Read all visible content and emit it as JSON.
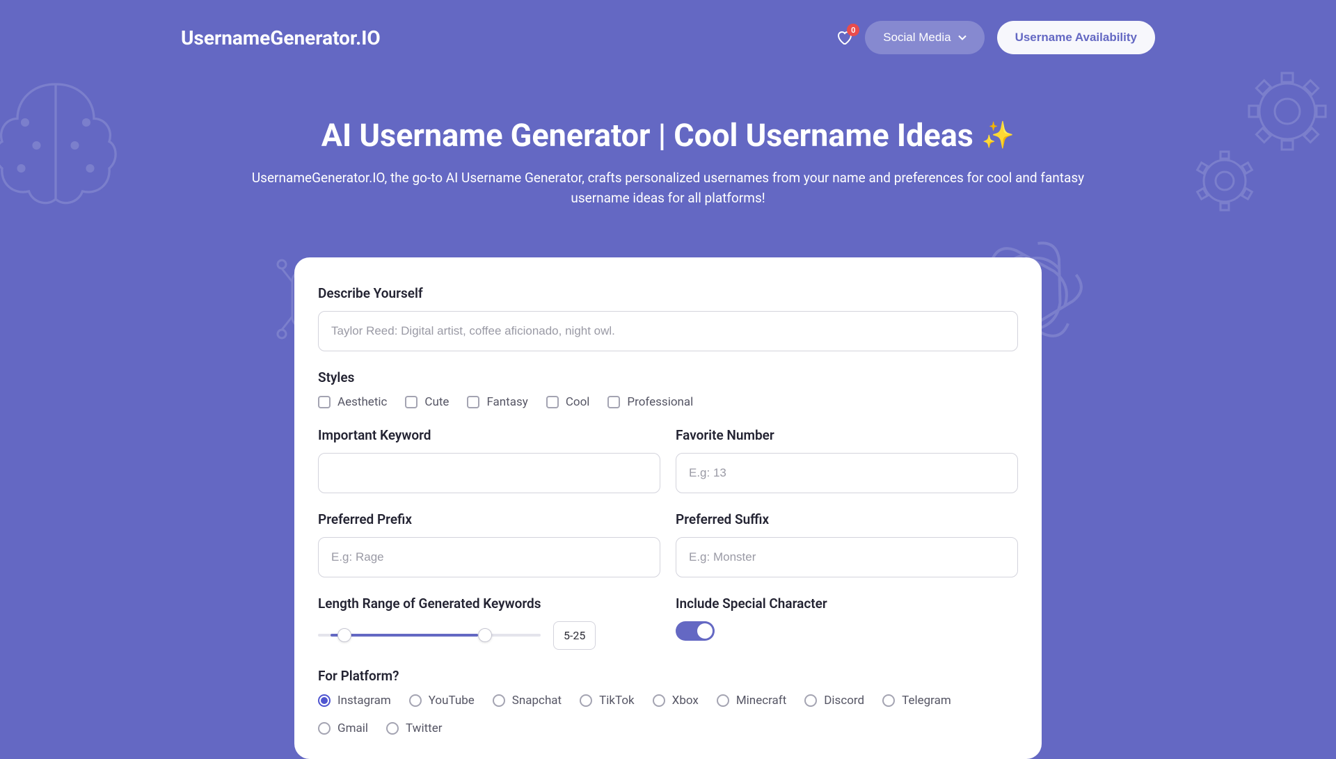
{
  "header": {
    "logo": "UsernameGenerator.IO",
    "badge_count": "0",
    "social_label": "Social Media",
    "availability_label": "Username Availability"
  },
  "hero": {
    "title": "AI Username Generator | Cool Username Ideas",
    "sparkle": "✨",
    "subtitle": "UsernameGenerator.IO, the go-to AI Username Generator, crafts personalized usernames from your name and preferences for cool and fantasy username ideas for all platforms!"
  },
  "form": {
    "describe_label": "Describe Yourself",
    "describe_placeholder": "Taylor Reed: Digital artist, coffee aficionado, night owl.",
    "styles_label": "Styles",
    "styles": [
      "Aesthetic",
      "Cute",
      "Fantasy",
      "Cool",
      "Professional"
    ],
    "keyword_label": "Important Keyword",
    "keyword_placeholder": "",
    "favnum_label": "Favorite Number",
    "favnum_placeholder": "E.g: 13",
    "prefix_label": "Preferred Prefix",
    "prefix_placeholder": "E.g: Rage",
    "suffix_label": "Preferred Suffix",
    "suffix_placeholder": "E.g: Monster",
    "length_label": "Length Range of Generated Keywords",
    "length_value": "5-25",
    "special_label": "Include Special Character",
    "platform_label": "For Platform?",
    "platforms": [
      "Instagram",
      "YouTube",
      "Snapchat",
      "TikTok",
      "Xbox",
      "Minecraft",
      "Discord",
      "Telegram",
      "Gmail",
      "Twitter"
    ],
    "platform_selected": "Instagram"
  }
}
